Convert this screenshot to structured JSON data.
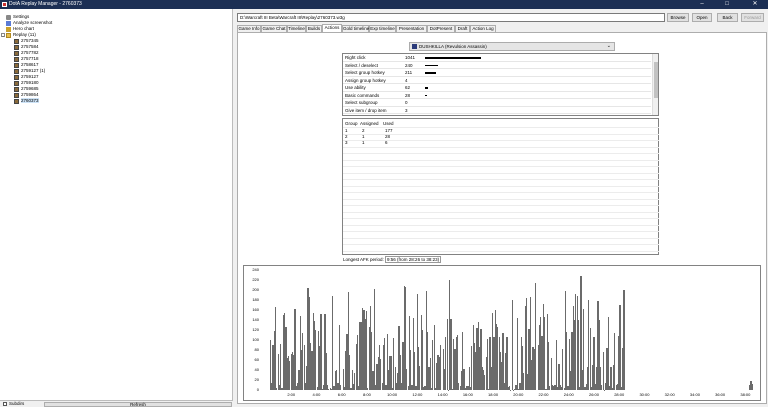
{
  "window": {
    "title": "DotA Replay Manager - 2760373",
    "controls": [
      "‒",
      "□",
      "✕"
    ]
  },
  "tree": {
    "top_items": [
      {
        "label": "Settings",
        "icon": "settings-icon"
      },
      {
        "label": "Analyze screenshot",
        "icon": "analyze-icon"
      },
      {
        "label": "Hero chart",
        "icon": "hero-chart-icon"
      }
    ],
    "folder": {
      "label": "Replay (11)",
      "expander": "-"
    },
    "replays": [
      "2757345",
      "2757584",
      "2757782",
      "2757718",
      "2758617",
      "2759127 (1)",
      "2759127",
      "2759180",
      "2759685",
      "2759864",
      "2760373"
    ],
    "selected": "2760373"
  },
  "bottom": {
    "checkbox_label": "Subdirs",
    "refresh_label": "Refresh"
  },
  "toolbar": {
    "path": "D:\\Warcraft III Beta\\Warcraft III\\Replay\\2760373.w3g",
    "browse": "Browse",
    "open": "Open",
    "back": "Back",
    "forward": "Forward"
  },
  "tabs": [
    "Game Info",
    "Game Chat",
    "Timeline",
    "Builds",
    "Actions",
    "Gold timeline",
    "Exp timeline",
    "Presentation",
    "DotPresent",
    "Draft",
    "Action Log"
  ],
  "active_tab": "Actions",
  "player_select": {
    "value": "DUSHKILLA (Revulsion Assassin)"
  },
  "actions": {
    "rows": [
      {
        "name": "Right click",
        "value": "1041",
        "fraction": 1.0
      },
      {
        "name": "Select / deselect",
        "value": "240",
        "fraction": 0.23
      },
      {
        "name": "Select group hotkey",
        "value": "211",
        "fraction": 0.2
      },
      {
        "name": "Assign group hotkey",
        "value": "4",
        "fraction": 0
      },
      {
        "name": "Use ability",
        "value": "62",
        "fraction": 0.06
      },
      {
        "name": "Basic commands",
        "value": "28",
        "fraction": 0.03
      },
      {
        "name": "Select subgroup",
        "value": "0",
        "fraction": 0
      },
      {
        "name": "Give item / drop item",
        "value": "3",
        "fraction": 0
      }
    ]
  },
  "groups": {
    "headers": [
      "Group",
      "Assigned",
      "Used"
    ],
    "rows": [
      [
        "1",
        "2",
        "177"
      ],
      [
        "2",
        "1",
        "28"
      ],
      [
        "3",
        "1",
        "6"
      ]
    ]
  },
  "afk": {
    "label": "Longest AFK period:",
    "value": "9:56 (from 28:26 to 38:23)"
  },
  "chart_data": {
    "type": "bar",
    "ylim": [
      0,
      240
    ],
    "yticks": [
      "240",
      "220",
      "200",
      "180",
      "160",
      "140",
      "120",
      "100",
      "80",
      "60",
      "40",
      "20",
      "0"
    ],
    "xticks": [
      "2:00",
      "4:00",
      "6:00",
      "8:00",
      "10:00",
      "12:00",
      "14:00",
      "16:00",
      "18:00",
      "20:00",
      "22:00",
      "24:00",
      "26:00",
      "28:00",
      "30:00",
      "32:00",
      "34:00",
      "36:00",
      "38:00"
    ],
    "xlim_minutes": [
      0,
      39
    ],
    "bar_color": "#6b6b6b",
    "active_ranges_minutes": [
      [
        0.3,
        28.4
      ],
      [
        38.3,
        38.6
      ]
    ],
    "peak": 235
  }
}
